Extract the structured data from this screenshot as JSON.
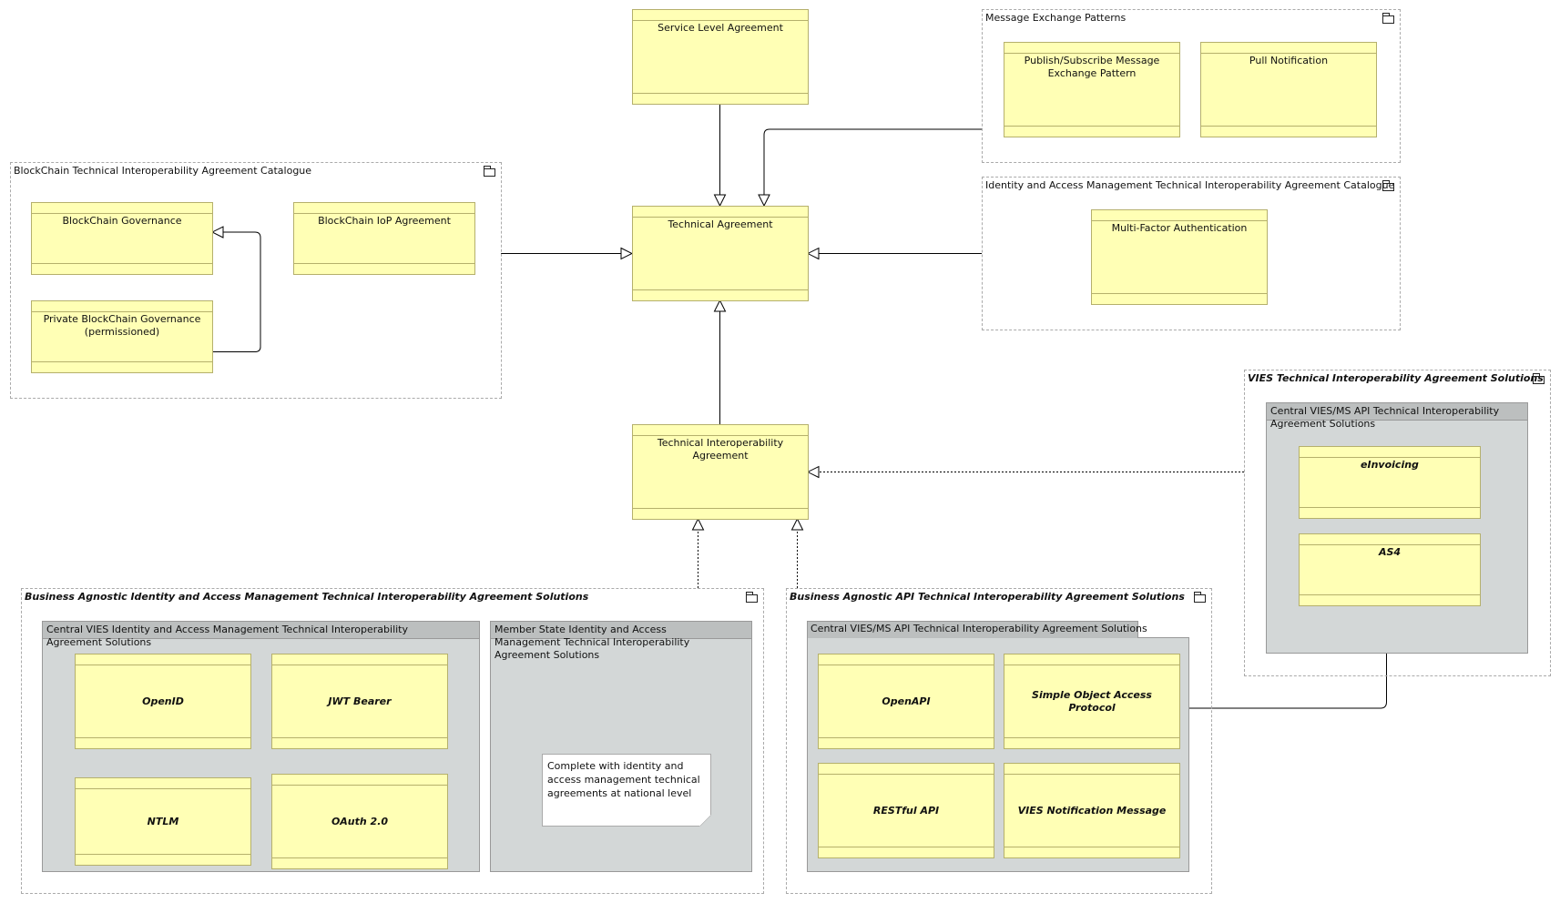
{
  "elements": {
    "sla": "Service Level Agreement",
    "technical_agreement": "Technical Agreement",
    "technical_interoperability_agreement": "Technical Interoperability Agreement",
    "blockchain_governance": "BlockChain Governance",
    "blockchain_iop": "BlockChain IoP Agreement",
    "private_blockchain": "Private BlockChain Governance (permissioned)",
    "pubsub": "Publish/Subscribe Message Exchange Pattern",
    "pull_notification": "Pull Notification",
    "mfa": "Multi-Factor Authentication",
    "einvoicing": "eInvoicing",
    "as4": "AS4",
    "openid": "OpenID",
    "jwt": "JWT Bearer",
    "ntlm": "NTLM",
    "oauth": "OAuth 2.0",
    "openapi": "OpenAPI",
    "soap": "Simple Object Access Protocol",
    "restful": "RESTful API",
    "vies_notification": "VIES Notification Message"
  },
  "containers": {
    "blockchain": "BlockChain Technical Interoperability Agreement Catalogue",
    "message_exchange": "Message Exchange Patterns",
    "iam_catalogue": "Identity and Access Management Technical Interoperability Agreement Catalogue",
    "vies": "VIES Technical Interoperability Agreement Solutions",
    "ba_iam": "Business Agnostic Identity and Access Management Technical Interoperability Agreement Solutions",
    "ba_api": "Business Agnostic API Technical Interoperability Agreement Solutions"
  },
  "groups": {
    "vies_central_api": "Central VIES/MS API Technical Interoperability Agreement Solutions",
    "central_iam": "Central VIES Identity and Access Management Technical Interoperability Agreement Solutions",
    "member_state_iam": "Member State Identity and Access Management Technical Interoperability Agreement Solutions",
    "api_central": "Central VIES/MS API Technical Interoperability Agreement Solutions"
  },
  "note": "Complete with identity and access management technical agreements at national level"
}
